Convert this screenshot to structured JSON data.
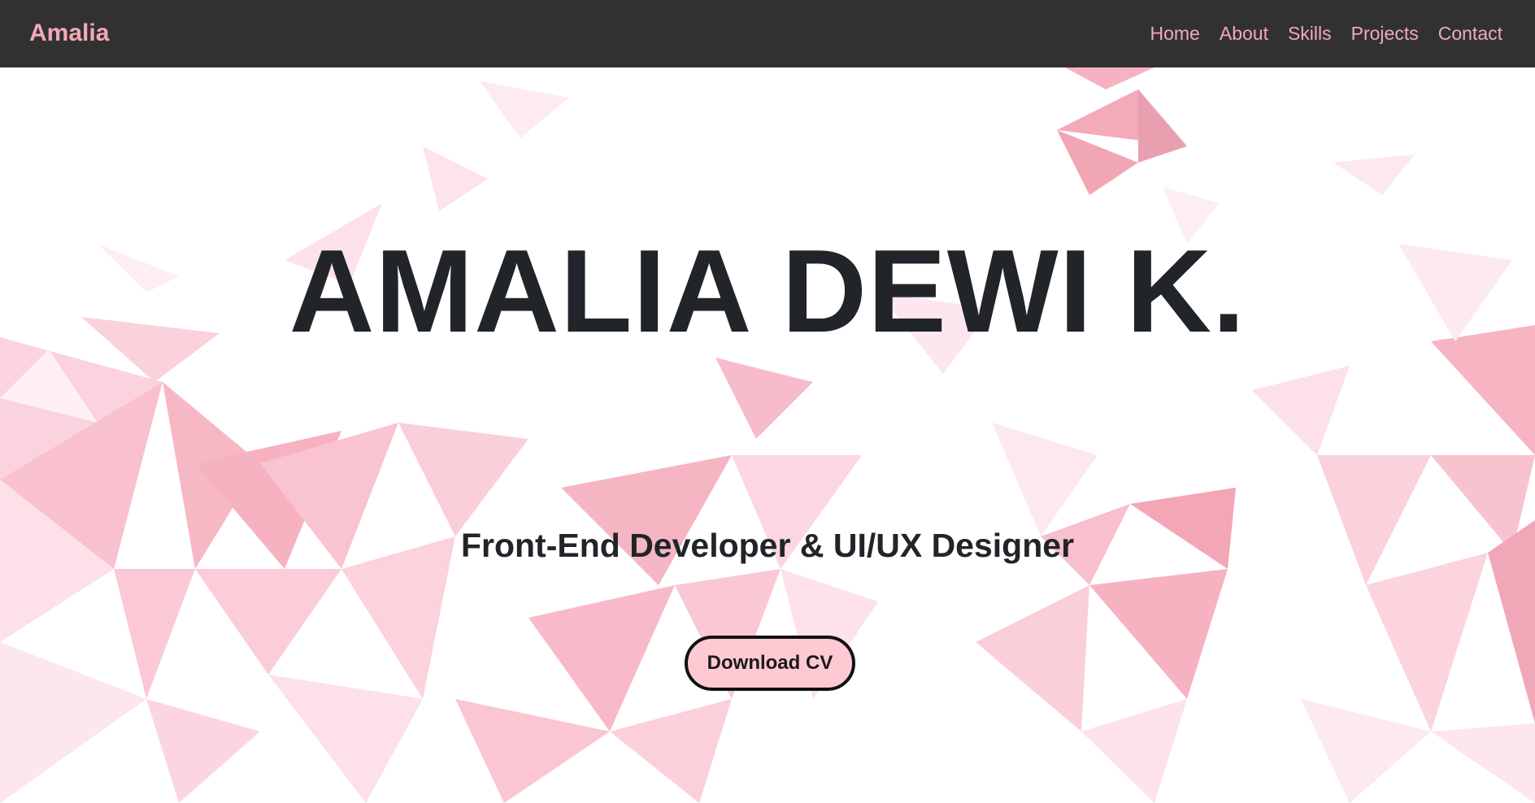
{
  "navbar": {
    "brand": "Amalia",
    "links": [
      "Home",
      "About",
      "Skills",
      "Projects",
      "Contact"
    ]
  },
  "hero": {
    "title": "AMALIA DEWI K.",
    "subtitle": "Front-End Developer & UI/UX Designer",
    "cta_label": "Download CV"
  },
  "colors": {
    "navbar_bg": "#313131",
    "accent_pink": "#f3a9b8",
    "text_dark": "#212428",
    "button_bg": "#ffc9d3"
  }
}
